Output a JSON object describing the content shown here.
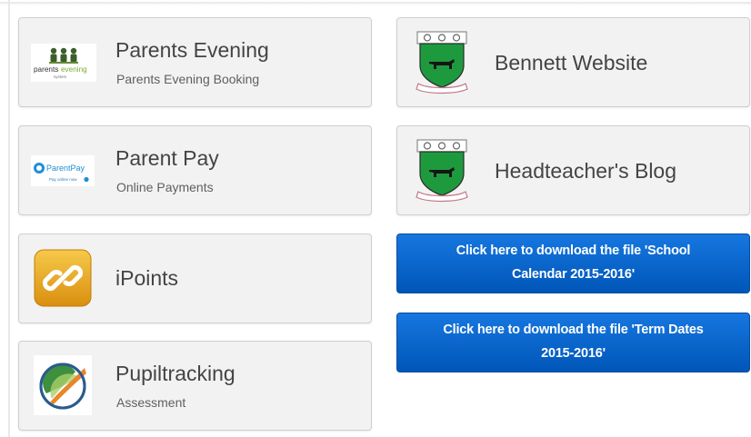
{
  "tiles": {
    "parents_evening": {
      "title": "Parents Evening",
      "subtitle": "Parents Evening Booking",
      "logo_text_a": "parents",
      "logo_text_b": "evening",
      "logo_text_c": "system",
      "logo_icon": "people-group-icon"
    },
    "parent_pay": {
      "title": "Parent Pay",
      "subtitle": "Online Payments",
      "logo_text": "ParentPay",
      "logo_tagline": "Pay online now",
      "logo_icon": "parentpay-logo"
    },
    "ipoints": {
      "title": "iPoints",
      "logo_icon": "link-chain-icon"
    },
    "pupiltracking": {
      "title": "Pupiltracking",
      "subtitle": "Assessment",
      "logo_icon": "pupiltracking-logo"
    },
    "bennett_website": {
      "title": "Bennett Website",
      "logo_icon": "school-crest-icon"
    },
    "headteachers_blog": {
      "title": "Headteacher's Blog",
      "logo_icon": "school-crest-icon"
    }
  },
  "downloads": {
    "calendar": {
      "line1": "Click here to download the file 'School",
      "line2": "Calendar 2015-2016'"
    },
    "term_dates": {
      "line1": "Click here to download the file 'Term Dates",
      "line2": "2015-2016'"
    }
  },
  "colors": {
    "tile_bg": "#f2f2f2",
    "button_blue": "#0a66cc",
    "crest_green": "#1e9a3e"
  }
}
